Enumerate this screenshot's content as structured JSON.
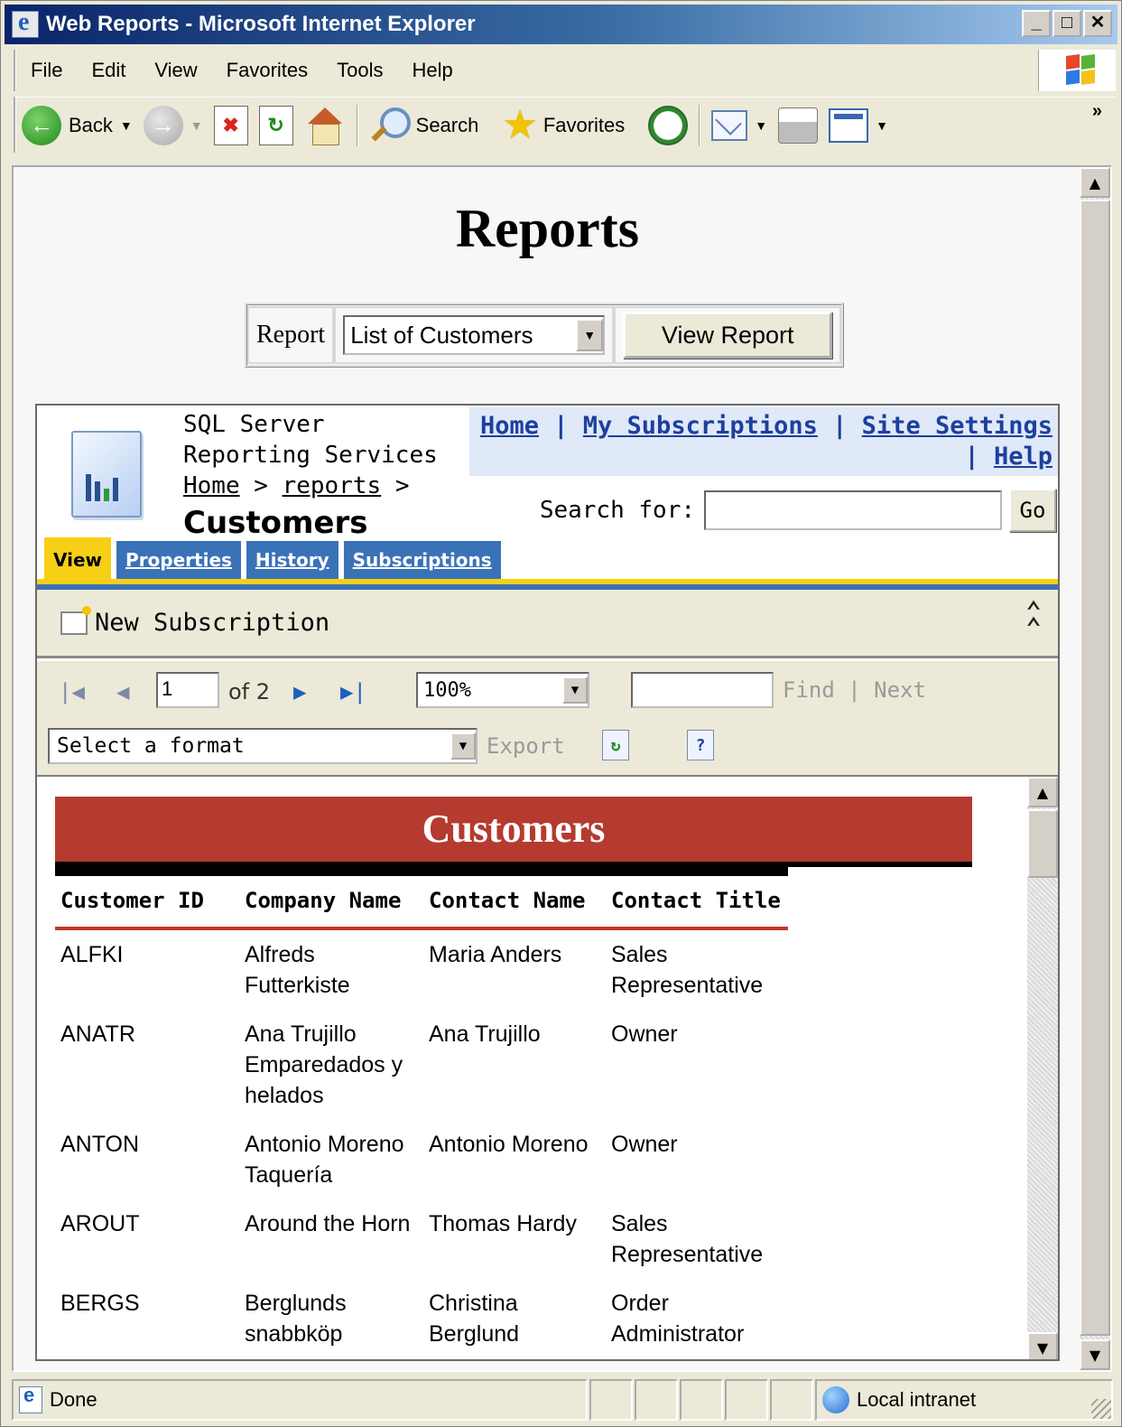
{
  "window": {
    "title": "Web Reports - Microsoft Internet Explorer",
    "buttons": [
      "_",
      "□",
      "✕"
    ]
  },
  "menu": [
    "File",
    "Edit",
    "View",
    "Favorites",
    "Tools",
    "Help"
  ],
  "toolbar": {
    "back": "Back",
    "search": "Search",
    "favorites": "Favorites",
    "more": "»"
  },
  "page": {
    "title": "Reports",
    "report_label": "Report",
    "report_selected": "List of Customers",
    "view_button": "View Report"
  },
  "ssrs": {
    "app_title": "SQL Server Reporting Services",
    "links": {
      "home": "Home",
      "subscriptions": "My Subscriptions",
      "settings": "Site Settings",
      "help": "Help",
      "sep": "|"
    },
    "breadcrumb": {
      "home": "Home",
      "reports": "reports",
      "sep": ">"
    },
    "heading": "Customers",
    "search_label": "Search for:",
    "go": "Go",
    "tabs": [
      "View",
      "Properties",
      "History",
      "Subscriptions"
    ],
    "active_tab": "View",
    "new_subscription": "New Subscription"
  },
  "viewer": {
    "page_current": "1",
    "page_of": "of 2",
    "zoom": "100%",
    "find": "Find",
    "find_sep": "|",
    "next": "Next",
    "format_placeholder": "Select a format",
    "export": "Export"
  },
  "report": {
    "title": "Customers",
    "columns": [
      "Customer ID",
      "Company Name",
      "Contact Name",
      "Contact Title"
    ],
    "rows": [
      {
        "id": "ALFKI",
        "company": "Alfreds Futterkiste",
        "contact": "Maria Anders",
        "title": "Sales Representative"
      },
      {
        "id": "ANATR",
        "company": "Ana Trujillo Emparedados y helados",
        "contact": "Ana Trujillo",
        "title": "Owner"
      },
      {
        "id": "ANTON",
        "company": "Antonio Moreno Taquería",
        "contact": "Antonio Moreno",
        "title": "Owner"
      },
      {
        "id": "AROUT",
        "company": "Around the Horn",
        "contact": "Thomas Hardy",
        "title": "Sales Representative"
      },
      {
        "id": "BERGS",
        "company": "Berglunds snabbköp",
        "contact": "Christina Berglund",
        "title": "Order Administrator"
      }
    ]
  },
  "status": {
    "text": "Done",
    "zone": "Local intranet"
  }
}
